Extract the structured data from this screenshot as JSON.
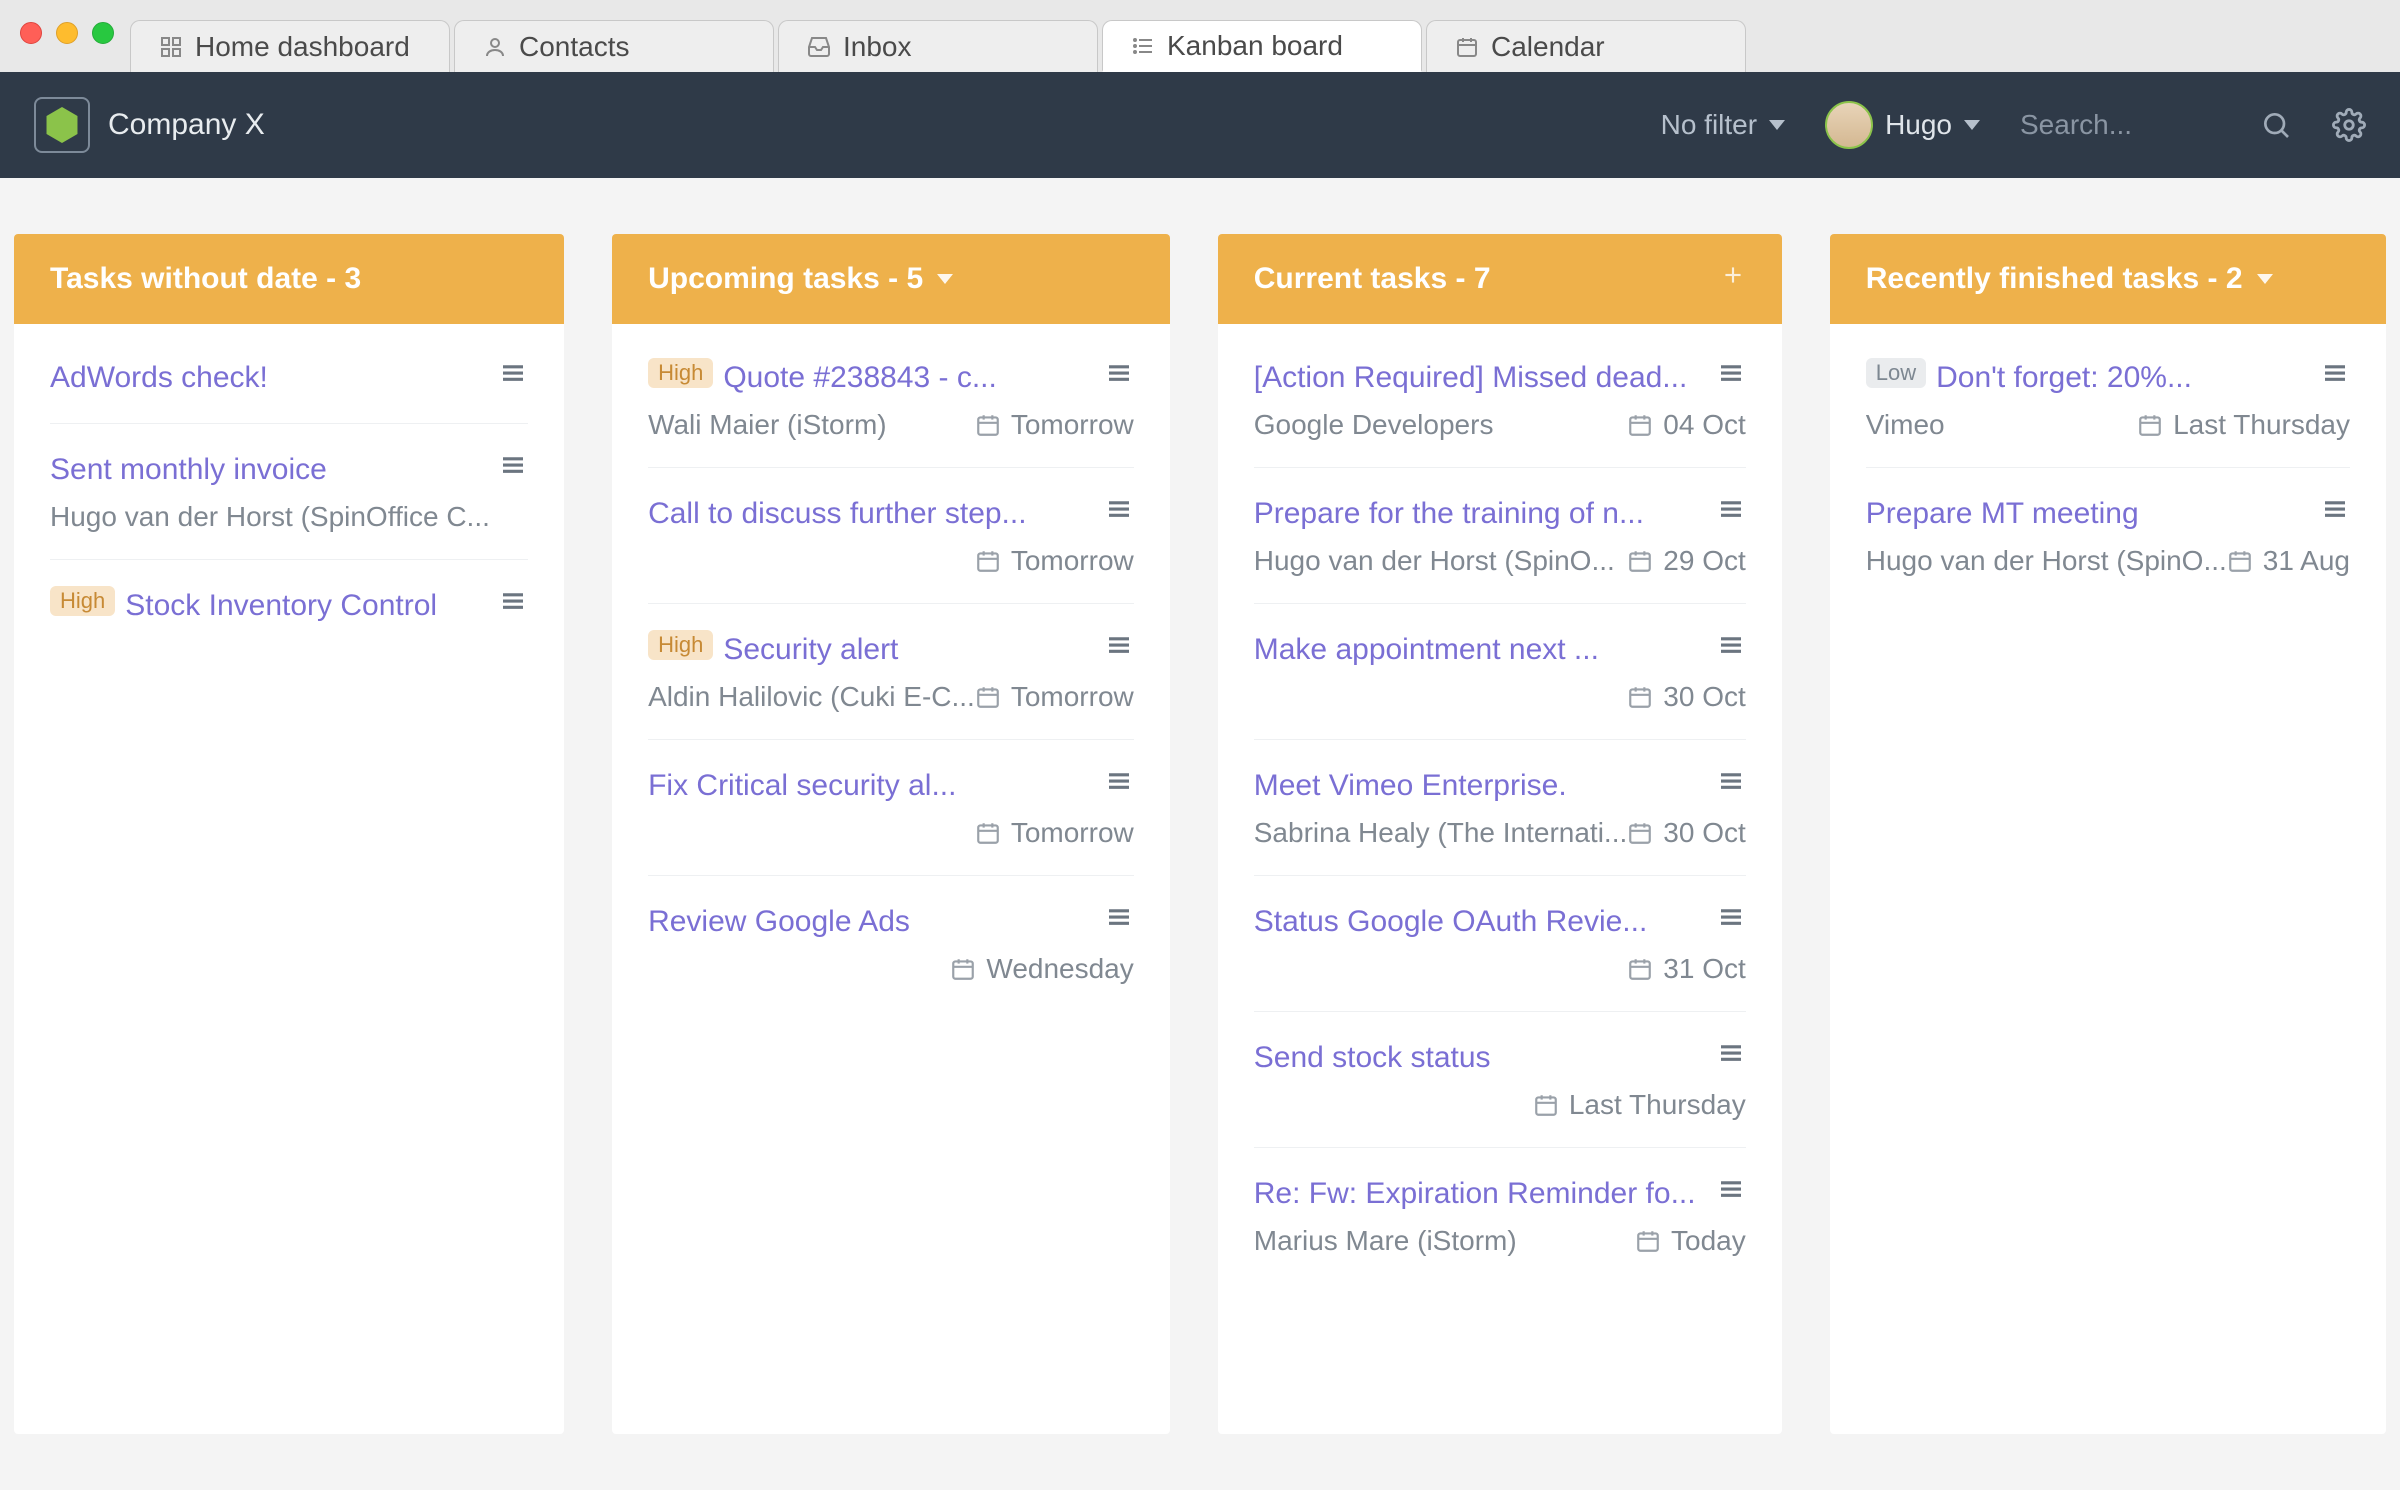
{
  "window": {
    "tabs": [
      {
        "label": "Home dashboard",
        "active": false,
        "icon": "grid-icon"
      },
      {
        "label": "Contacts",
        "active": false,
        "icon": "person-icon"
      },
      {
        "label": "Inbox",
        "active": false,
        "icon": "inbox-icon"
      },
      {
        "label": "Kanban board",
        "active": true,
        "icon": "list-icon"
      },
      {
        "label": "Calendar",
        "active": false,
        "icon": "calendar-icon"
      }
    ]
  },
  "header": {
    "company": "Company X",
    "filter_label": "No filter",
    "user_name": "Hugo",
    "search_placeholder": "Search..."
  },
  "columns": [
    {
      "title": "Tasks without date - 3",
      "dropdown": false,
      "plus": false,
      "cards": [
        {
          "title": "AdWords check!",
          "badge": null,
          "subtitle": null,
          "date": null
        },
        {
          "title": "Sent monthly invoice",
          "badge": null,
          "subtitle": "Hugo van der Horst (SpinOffice C...",
          "date": null
        },
        {
          "title": "Stock Inventory Control",
          "badge": "High",
          "subtitle": null,
          "date": null
        }
      ]
    },
    {
      "title": "Upcoming tasks - 5",
      "dropdown": true,
      "plus": false,
      "cards": [
        {
          "title": "Quote #238843 - c...",
          "badge": "High",
          "subtitle": "Wali Maier (iStorm)",
          "date": "Tomorrow"
        },
        {
          "title": "Call to discuss further step...",
          "badge": null,
          "subtitle": null,
          "date": "Tomorrow"
        },
        {
          "title": "Security alert",
          "badge": "High",
          "subtitle": "Aldin Halilovic (Cuki E-C...",
          "date": "Tomorrow"
        },
        {
          "title": "Fix Critical security al...",
          "badge": null,
          "subtitle": null,
          "date": "Tomorrow"
        },
        {
          "title": "Review Google Ads",
          "badge": null,
          "subtitle": null,
          "date": "Wednesday"
        }
      ]
    },
    {
      "title": "Current tasks - 7",
      "dropdown": false,
      "plus": true,
      "cards": [
        {
          "title": "[Action Required] Missed dead...",
          "badge": null,
          "subtitle": "Google Developers",
          "date": "04 Oct"
        },
        {
          "title": "Prepare for the training of n...",
          "badge": null,
          "subtitle": "Hugo van der Horst (SpinO...",
          "date": "29 Oct"
        },
        {
          "title": "Make appointment next ...",
          "badge": null,
          "subtitle": null,
          "date": "30 Oct"
        },
        {
          "title": "Meet Vimeo Enterprise.",
          "badge": null,
          "subtitle": "Sabrina Healy (The Internati...",
          "date": "30 Oct"
        },
        {
          "title": "Status Google OAuth Revie...",
          "badge": null,
          "subtitle": null,
          "date": "31 Oct"
        },
        {
          "title": "Send stock status",
          "badge": null,
          "subtitle": null,
          "date": "Last Thursday"
        },
        {
          "title": "Re: Fw: Expiration Reminder fo...",
          "badge": null,
          "subtitle": "Marius Mare (iStorm)",
          "date": "Today"
        }
      ]
    },
    {
      "title": "Recently finished tasks - 2",
      "dropdown": true,
      "plus": false,
      "cards": [
        {
          "title": "Don't forget: 20%...",
          "badge": "Low",
          "subtitle": "Vimeo",
          "date": "Last Thursday"
        },
        {
          "title": "Prepare MT meeting",
          "badge": null,
          "subtitle": "Hugo van der Horst (SpinO...",
          "date": "31 Aug"
        }
      ]
    }
  ]
}
